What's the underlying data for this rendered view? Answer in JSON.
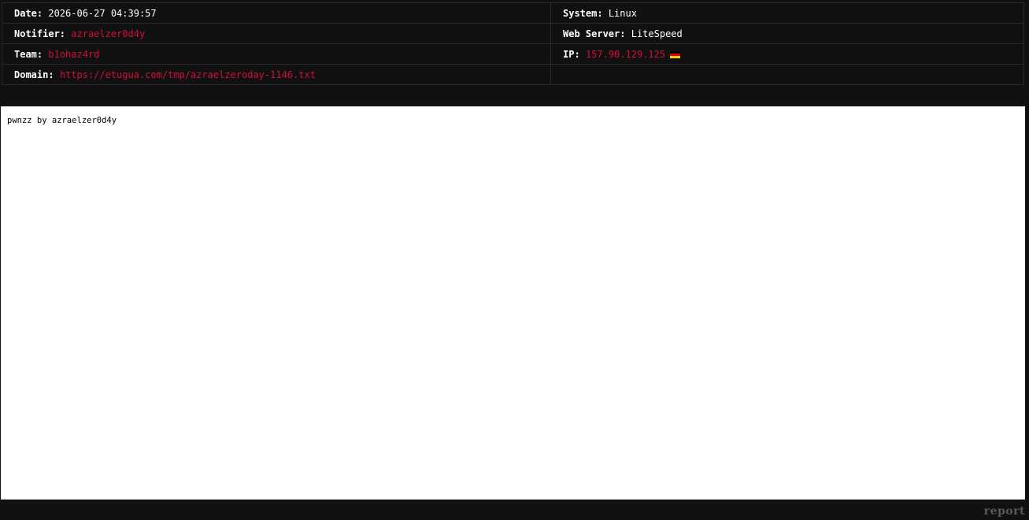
{
  "info": {
    "date": {
      "label": "Date:",
      "value": "2026-06-27 04:39:57"
    },
    "system": {
      "label": "System:",
      "value": "Linux"
    },
    "notifier": {
      "label": "Notifier:",
      "value": "azraelzer0d4y"
    },
    "web_server": {
      "label": "Web Server:",
      "value": "LiteSpeed"
    },
    "team": {
      "label": "Team:",
      "value": "b1ohaz4rd"
    },
    "ip": {
      "label": "IP:",
      "value": "157.90.129.125",
      "flag_icon": "germany-flag-icon"
    },
    "domain": {
      "label": "Domain:",
      "value": "https://etugua.com/tmp/azraelzeroday-1146.txt"
    }
  },
  "frame": {
    "text": "pwnzz by azraelzer0d4y"
  },
  "footer": {
    "report_label": "report"
  },
  "colors": {
    "background": "#111111",
    "accent_red": "#d0103a",
    "frame_background": "#ffffff",
    "report_gray": "#5a5a5a",
    "flag": [
      "#000000",
      "#dd0000",
      "#ffce00"
    ]
  }
}
